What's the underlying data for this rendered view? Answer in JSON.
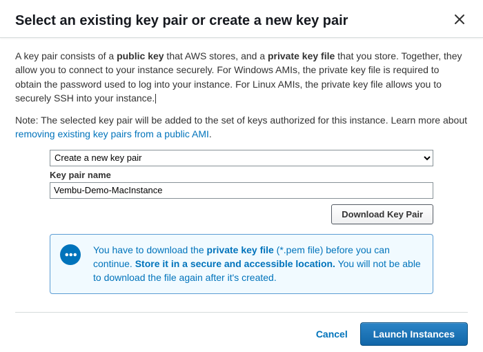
{
  "header": {
    "title": "Select an existing key pair or create a new key pair"
  },
  "body": {
    "intro_pre": "A key pair consists of a ",
    "public_key_bold": "public key",
    "intro_mid": " that AWS stores, and a ",
    "private_key_bold": "private key file",
    "intro_post": " that you store. Together, they allow you to connect to your instance securely. For Windows AMIs, the private key file is required to obtain the password used to log into your instance. For Linux AMIs, the private key file allows you to securely SSH into your instance.",
    "note_pre": "Note: The selected key pair will be added to the set of keys authorized for this instance. Learn more about ",
    "note_link": "removing existing key pairs from a public AMI",
    "note_post": "."
  },
  "form": {
    "select_options": [
      "Create a new key pair"
    ],
    "select_value": "Create a new key pair",
    "keypair_name_label": "Key pair name",
    "keypair_name_value": "Vembu-Demo-MacInstance",
    "download_button": "Download Key Pair"
  },
  "alert": {
    "t1": "You have to download the ",
    "t2_bold": "private key file",
    "t3": " (*.pem file) before you can continue. ",
    "t4_bold": "Store it in a secure and accessible location.",
    "t5": " You will not be able to download the file again after it's created."
  },
  "footer": {
    "cancel": "Cancel",
    "launch": "Launch Instances"
  }
}
